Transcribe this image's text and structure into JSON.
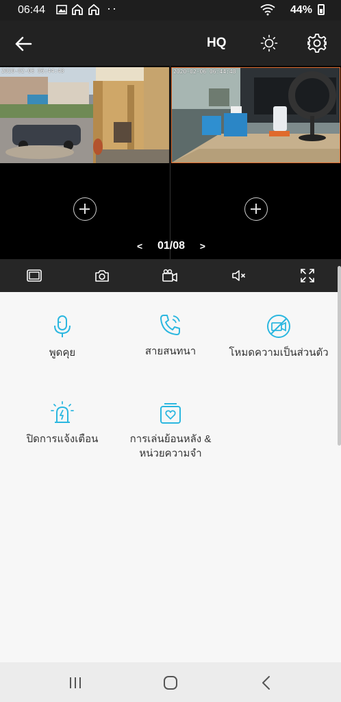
{
  "status_bar": {
    "time": "06:44",
    "battery_pct": "44%",
    "dots": "··"
  },
  "header": {
    "quality_label": "HQ"
  },
  "cameras": {
    "feeds": [
      {
        "timestamp": "2020-02-06 06:44:48"
      },
      {
        "timestamp": "2020-02-06 06:44:48"
      }
    ],
    "pager": {
      "prev": "<",
      "page": "01/08",
      "next": ">"
    }
  },
  "actions": [
    {
      "label": "พูดคุย",
      "icon": "microphone-icon"
    },
    {
      "label": "สายสนทนา",
      "icon": "phone-call-icon"
    },
    {
      "label": "โหมดความเป็นส่วนตัว",
      "icon": "privacy-mode-icon"
    },
    {
      "label": "ปิดการแจ้งเตือน",
      "icon": "alarm-icon"
    },
    {
      "label": "การเล่นย้อนหลัง &",
      "label2": "หน่วยความจำ",
      "icon": "playback-icon"
    }
  ],
  "colors": {
    "accent": "#2bb7e0",
    "header_bg": "#222222",
    "selected_border": "#e06a2c"
  }
}
